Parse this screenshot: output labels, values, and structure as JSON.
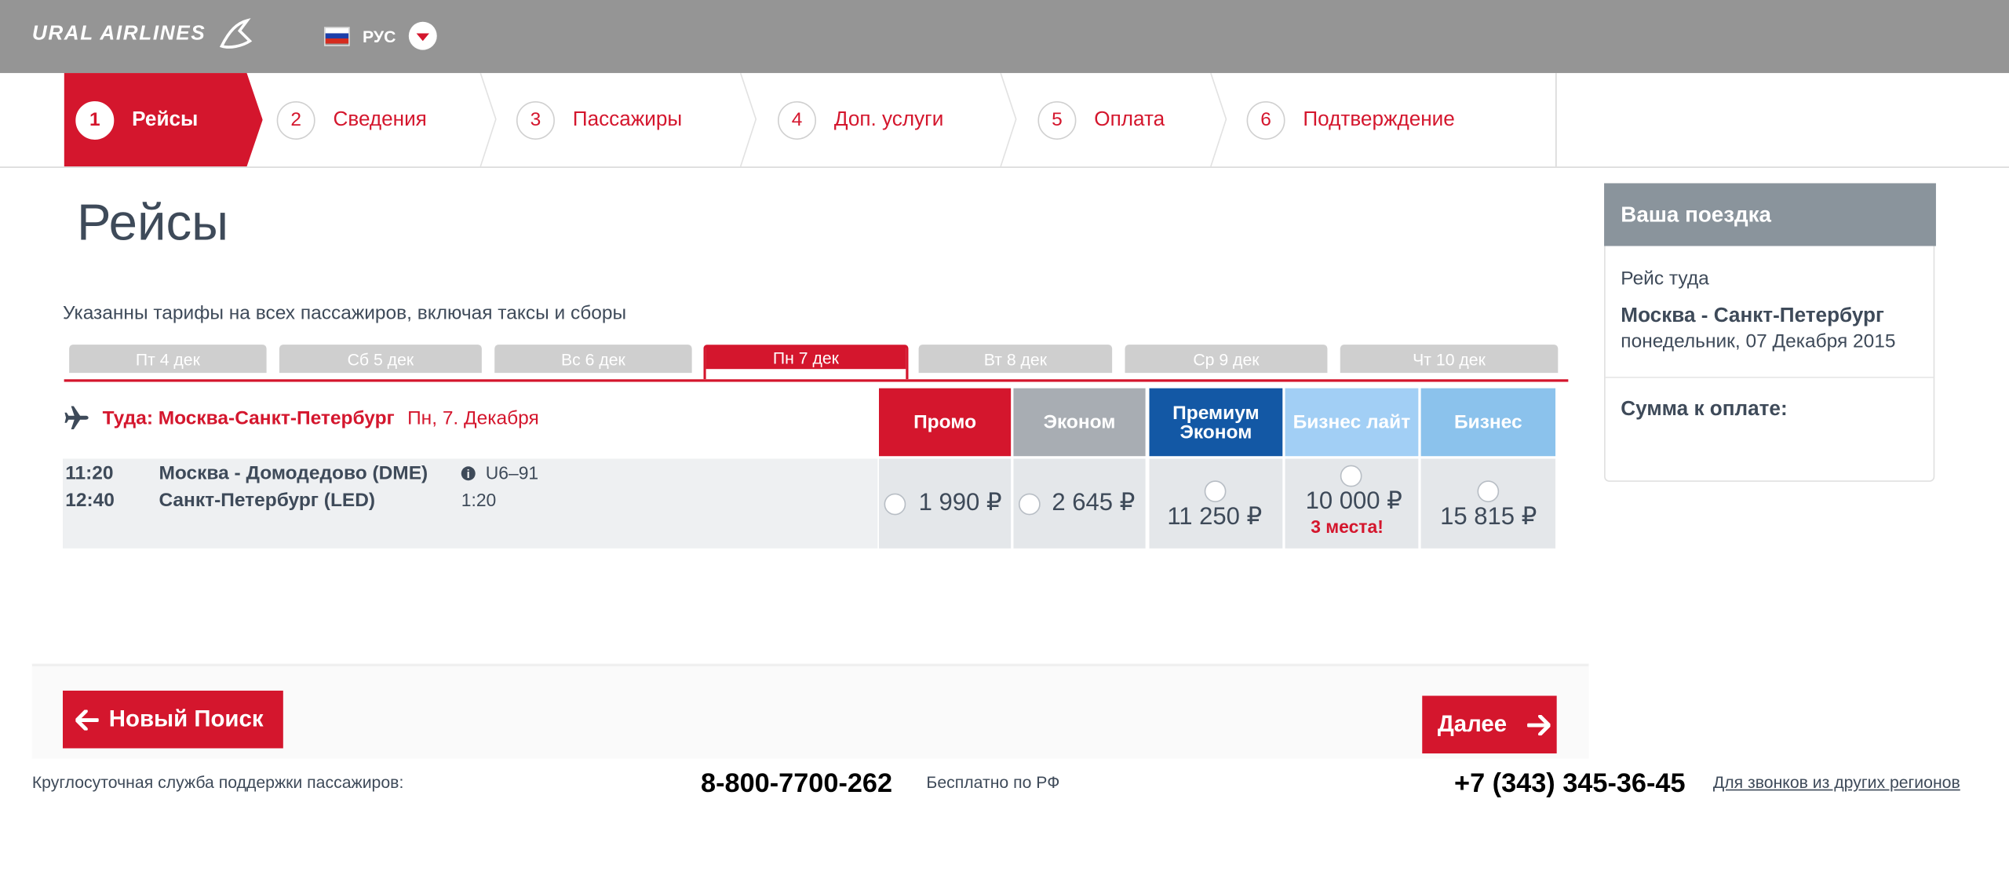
{
  "header": {
    "logo_text": "URAL AIRLINES",
    "language": "РУС",
    "colors": {
      "bar": "#959595",
      "accent": "#d4162d"
    }
  },
  "steps": [
    {
      "num": "1",
      "label": "Рейсы",
      "active": true
    },
    {
      "num": "2",
      "label": "Сведения"
    },
    {
      "num": "3",
      "label": "Пассажиры"
    },
    {
      "num": "4",
      "label": "Доп. услуги"
    },
    {
      "num": "5",
      "label": "Оплата"
    },
    {
      "num": "6",
      "label": "Подтверждение"
    }
  ],
  "page": {
    "title": "Рейсы",
    "note": "Указанны тарифы на всех пассажиров, включая таксы и сборы"
  },
  "date_tabs": [
    "Пт 4 дек",
    "Сб 5 дек",
    "Вс 6 дек",
    "Пн 7 дек",
    "Вт 8 дек",
    "Ср 9 дек",
    "Чт 10 дек"
  ],
  "selected_date": "Пн 7 дек",
  "route": {
    "label": "Туда: Москва-Санкт-Петербург",
    "date": "Пн, 7. Декабря",
    "icon": "plane-icon"
  },
  "fare_classes": [
    {
      "name": "Промо",
      "color": "#d4162d"
    },
    {
      "name": "Эконом",
      "color": "#a8adb3"
    },
    {
      "name": "Премиум Эконом",
      "color": "#1358a5"
    },
    {
      "name": "Бизнес лайт",
      "color": "#a2cff5"
    },
    {
      "name": "Бизнес",
      "color": "#8bc2ec"
    }
  ],
  "flight": {
    "depart_time": "11:20",
    "arrive_time": "12:40",
    "depart_airport": "Москва - Домодедово (DME)",
    "arrive_airport": "Санкт-Петербург (LED)",
    "flight_number": "U6–91",
    "duration": "1:20",
    "fares": [
      {
        "price": "1 990 ₽"
      },
      {
        "price": "2 645 ₽"
      },
      {
        "price": "11 250 ₽"
      },
      {
        "price": "10 000 ₽",
        "warning": "3 места!"
      },
      {
        "price": "15 815 ₽"
      }
    ]
  },
  "sidebar": {
    "title": "Ваша поездка",
    "leg_label": "Рейс туда",
    "route": "Москва - Санкт-Петербург",
    "date": "понедельник, 07 Декабря 2015",
    "total_label": "Сумма к оплате:"
  },
  "buttons": {
    "new_search": "Новый Поиск",
    "next": "Далее"
  },
  "footer": {
    "support_label": "Круглосуточная служба поддержки пассажиров:",
    "phone_free": "8-800-7700-262",
    "free_note": "Бесплатно по РФ",
    "phone_regional": "+7 (343) 345-36-45",
    "regional_link": "Для звонков из других регионов"
  }
}
